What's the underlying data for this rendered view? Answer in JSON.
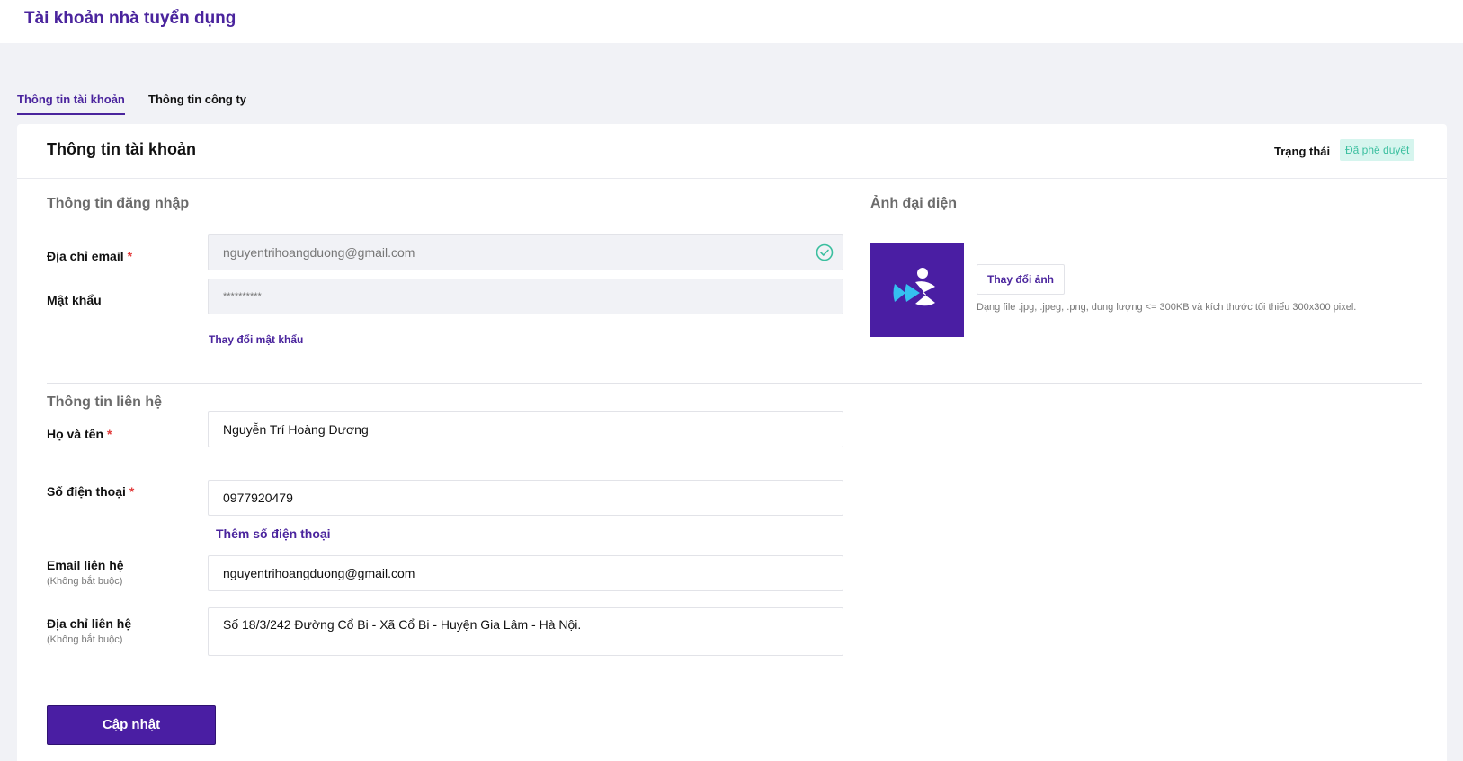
{
  "page": {
    "title": "Tài khoản nhà tuyển dụng"
  },
  "tabs": [
    {
      "label": "Thông tin tài khoản",
      "active": true
    },
    {
      "label": "Thông tin công ty",
      "active": false
    }
  ],
  "card": {
    "title": "Thông tin tài khoản",
    "status_label": "Trạng thái",
    "status_value": "Đã phê duyệt"
  },
  "login": {
    "section_title": "Thông tin đăng nhập",
    "email_label": "Địa chỉ email",
    "email_value": "nguyentrihoangduong@gmail.com",
    "password_label": "Mật khẩu",
    "password_value": "**********",
    "change_password": "Thay đổi mật khẩu"
  },
  "avatar": {
    "section_title": "Ảnh đại diện",
    "change_button": "Thay đổi ảnh",
    "hint": "Dạng file .jpg, .jpeg, .png, dung lượng <= 300KB và kích thước tối thiểu 300x300 pixel."
  },
  "contact": {
    "section_title": "Thông tin liên hệ",
    "name_label": "Họ và tên",
    "name_value": "Nguyễn Trí Hoàng Dương",
    "phone_label": "Số điện thoại",
    "phone_value": "0977920479",
    "add_phone": "Thêm số điện thoại",
    "email_label": "Email liên hệ",
    "email_optional": "(Không bắt buộc)",
    "email_value": "nguyentrihoangduong@gmail.com",
    "address_label": "Địa chỉ liên hệ",
    "address_optional": "(Không bắt buộc)",
    "address_value": "Số 18/3/242 Đường Cổ Bi - Xã Cổ Bi - Huyện Gia Lâm - Hà Nội."
  },
  "actions": {
    "submit": "Cập nhật"
  },
  "required_mark": "*",
  "colors": {
    "brand": "#4a249d",
    "status_bg": "#d6f5ee",
    "status_text": "#3bbf9f",
    "required": "#e23b3b"
  }
}
